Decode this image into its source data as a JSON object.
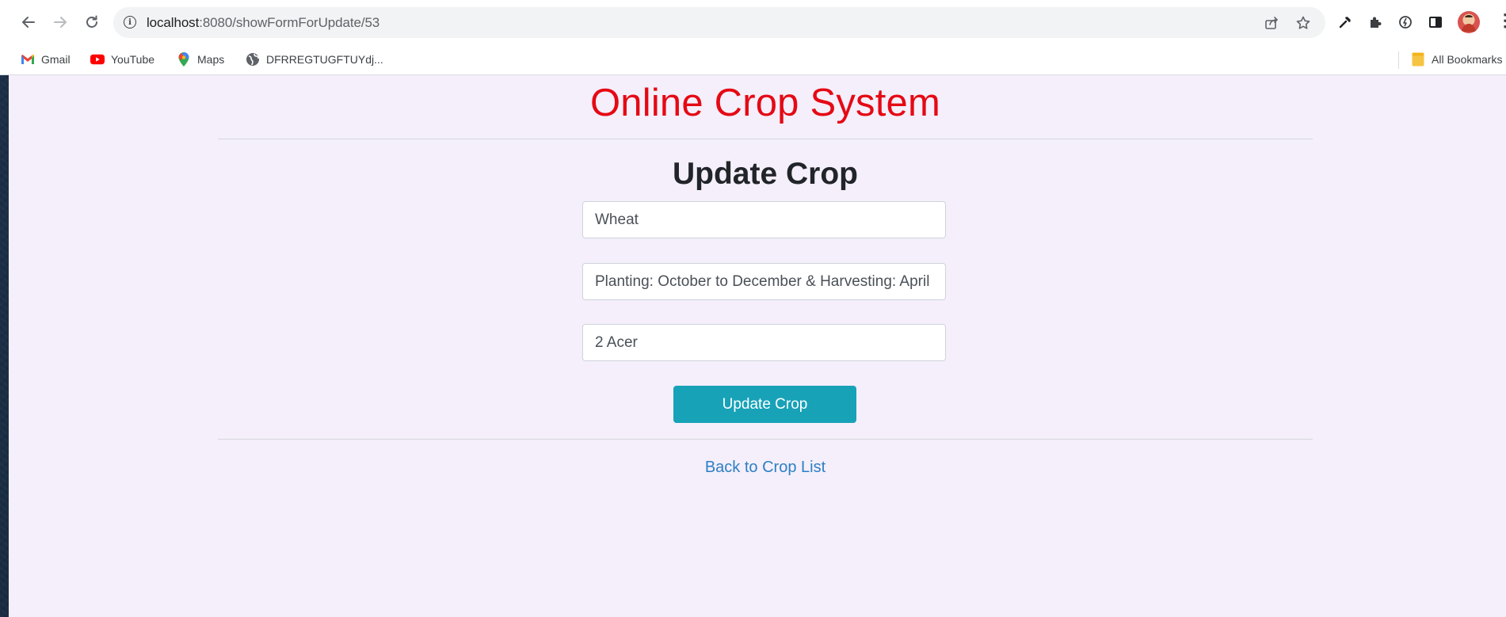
{
  "browser": {
    "url_host": "localhost",
    "url_path": ":8080/showFormForUpdate/53",
    "nav": {
      "back": "back-arrow-icon",
      "forward": "forward-arrow-icon",
      "reload": "reload-icon",
      "site_info": "i"
    },
    "omnibox_icons": [
      "share-icon",
      "bookmark-star-icon"
    ],
    "toolbar_icons": [
      "eyedropper-icon",
      "extensions-puzzle-icon",
      "performance-icon",
      "side-panel-icon",
      "profile-avatar",
      "menu-kebab-icon"
    ],
    "menu_glyph": "⋮"
  },
  "bookmarks": {
    "items": [
      {
        "label": "Gmail",
        "icon": "gmail-icon"
      },
      {
        "label": "YouTube",
        "icon": "youtube-icon"
      },
      {
        "label": "Maps",
        "icon": "maps-pin-icon"
      },
      {
        "label": "DFRREGTUGFTUYdj...",
        "icon": "globe-icon"
      }
    ],
    "all_bookmarks": {
      "label": "All Bookmarks",
      "icon": "folder-icon"
    }
  },
  "page": {
    "app_title": "Online Crop System",
    "form_title": "Update Crop",
    "fields": {
      "crop_name": "Wheat",
      "season": "Planting: October to December & Harvesting: April",
      "area": "2 Acer"
    },
    "submit_label": "Update Crop",
    "back_link": "Back to Crop List"
  },
  "colors": {
    "page_background": "#f4effb",
    "title_red": "#e50914",
    "button_teal": "#17a2b8",
    "link_blue": "#2d7fc4",
    "desktop_background": "#1d3146"
  }
}
